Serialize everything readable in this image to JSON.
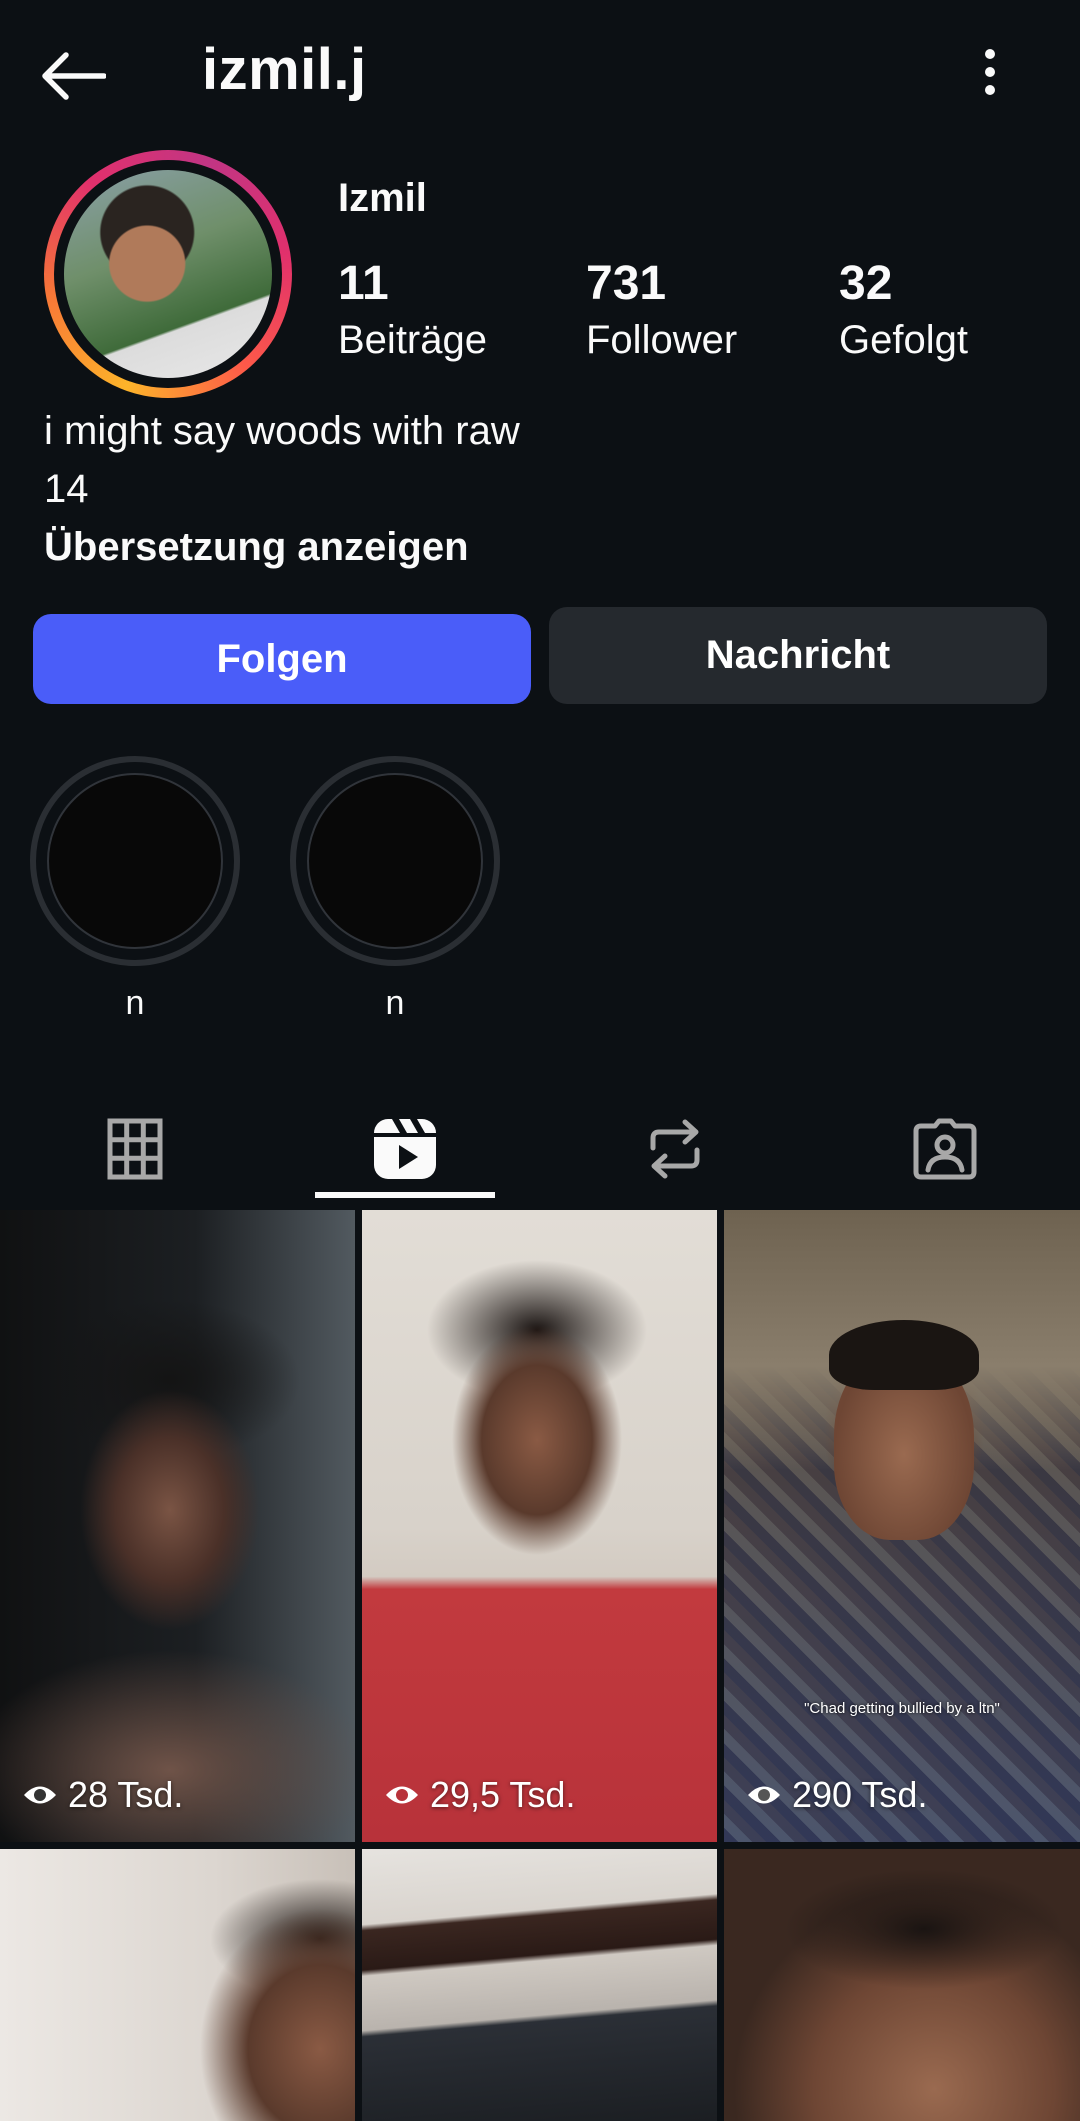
{
  "header": {
    "username": "izmil.j"
  },
  "profile": {
    "display_name": "Izmil",
    "stats": [
      {
        "value": "11",
        "label": "Beiträge"
      },
      {
        "value": "731",
        "label": "Follower"
      },
      {
        "value": "32",
        "label": "Gefolgt"
      }
    ],
    "bio_line1": "i might say woods with raw",
    "bio_line2": "14",
    "translate_label": "Übersetzung anzeigen"
  },
  "actions": {
    "follow_label": "Folgen",
    "message_label": "Nachricht"
  },
  "highlights": [
    {
      "label": "n"
    },
    {
      "label": "n"
    }
  ],
  "tabs": [
    {
      "icon": "grid-icon"
    },
    {
      "icon": "reels-icon",
      "active": true
    },
    {
      "icon": "repost-icon"
    },
    {
      "icon": "tagged-icon"
    }
  ],
  "reels": [
    {
      "views": "28 Tsd."
    },
    {
      "views": "29,5 Tsd."
    },
    {
      "views": "290 Tsd.",
      "caption": "\"Chad getting bullied by a ltn\""
    },
    {
      "views": ""
    },
    {
      "views": ""
    },
    {
      "views": ""
    }
  ],
  "colors": {
    "background": "#0c1014",
    "follow_button": "#4a5df9",
    "message_button": "#25292e",
    "text": "#fafafa"
  }
}
